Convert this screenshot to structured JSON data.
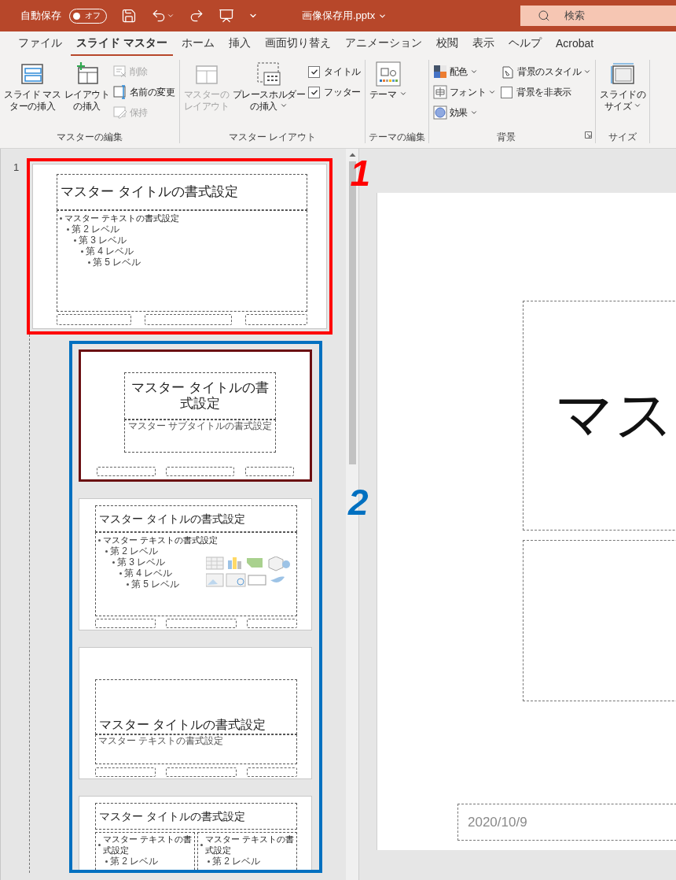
{
  "title_bar": {
    "autosave": {
      "label": "自動保存",
      "toggle": "オフ",
      "on": false
    },
    "file_name": "画像保存用.pptx",
    "search": {
      "placeholder": "検索"
    }
  },
  "tabs": [
    {
      "label": "ファイル",
      "selected": false
    },
    {
      "label": "スライド マスター",
      "selected": true
    },
    {
      "label": "ホーム",
      "selected": false
    },
    {
      "label": "挿入",
      "selected": false
    },
    {
      "label": "画面切り替え",
      "selected": false
    },
    {
      "label": "アニメーション",
      "selected": false
    },
    {
      "label": "校閲",
      "selected": false
    },
    {
      "label": "表示",
      "selected": false
    },
    {
      "label": "ヘルプ",
      "selected": false
    },
    {
      "label": "Acrobat",
      "selected": false
    }
  ],
  "ribbon": {
    "groups": [
      {
        "label": "マスターの編集",
        "items": [
          {
            "kind": "large",
            "lines": [
              "スライド マス",
              "ターの挿入"
            ],
            "disabled": false,
            "dropdown": false
          },
          {
            "kind": "large",
            "lines": [
              "レイアウト",
              "の挿入"
            ],
            "disabled": false,
            "dropdown": false
          },
          {
            "kind": "small",
            "label": "削除",
            "disabled": true,
            "dropdown": false
          },
          {
            "kind": "small",
            "label": "名前の変更",
            "disabled": false,
            "dropdown": false
          },
          {
            "kind": "small",
            "label": "保持",
            "disabled": true,
            "dropdown": false
          }
        ]
      },
      {
        "label": "マスター レイアウト",
        "items": [
          {
            "kind": "large",
            "lines": [
              "マスターの",
              "レイアウト"
            ],
            "disabled": true,
            "dropdown": false
          },
          {
            "kind": "large",
            "lines": [
              "プレースホルダー",
              "の挿入"
            ],
            "disabled": false,
            "dropdown": true
          },
          {
            "kind": "check",
            "label": "タイトル",
            "checked": true
          },
          {
            "kind": "check",
            "label": "フッター",
            "checked": true
          }
        ]
      },
      {
        "label": "テーマの編集",
        "items": [
          {
            "kind": "large",
            "lines": [
              "テーマ"
            ],
            "disabled": false,
            "dropdown": true
          }
        ]
      },
      {
        "label": "背景",
        "launcher": true,
        "items": [
          {
            "kind": "small",
            "label": "配色",
            "disabled": false,
            "dropdown": true
          },
          {
            "kind": "small",
            "label": "フォント",
            "disabled": false,
            "dropdown": true
          },
          {
            "kind": "small",
            "label": "効果",
            "disabled": false,
            "dropdown": true
          },
          {
            "kind": "small",
            "label": "背景のスタイル",
            "disabled": false,
            "dropdown": true
          },
          {
            "kind": "check",
            "label": "背景を非表示",
            "checked": false
          }
        ]
      },
      {
        "label": "サイズ",
        "items": [
          {
            "kind": "large",
            "lines": [
              "スライドの",
              "サイズ"
            ],
            "disabled": false,
            "dropdown": true
          }
        ]
      }
    ]
  },
  "slide_panel": {
    "master": {
      "number": "1",
      "selected": false,
      "title": "マスター タイトルの書式設定",
      "levels": [
        "マスター テキストの書式設定",
        "第 2 レベル",
        "第 3 レベル",
        "第 4 レベル",
        "第 5 レベル"
      ]
    },
    "layouts": [
      {
        "kind": "title",
        "selected": true,
        "title": "マスター タイトルの書式設定",
        "subtitle": "マスター サブタイトルの書式設定"
      },
      {
        "kind": "content",
        "selected": false,
        "title": "マスター タイトルの書式設定",
        "levels": [
          "マスター テキストの書式設定",
          "第 2 レベル",
          "第 3 レベル",
          "第 4 レベル",
          "第 5 レベル"
        ]
      },
      {
        "kind": "section",
        "selected": false,
        "title": "マスター タイトルの書式設定",
        "text": "マスター テキストの書式設定"
      },
      {
        "kind": "two_content",
        "selected": false,
        "title": "マスター タイトルの書式設定",
        "columns": [
          [
            "マスター テキストの書式設定",
            "第 2 レベル"
          ],
          [
            "マスター テキストの書式設定",
            "第 2 レベル"
          ]
        ]
      }
    ],
    "highlights": [
      {
        "label": "1",
        "color": "#ff0000"
      },
      {
        "label": "2",
        "color": "#0070c0"
      }
    ]
  },
  "slide_editor": {
    "title": "マス",
    "date": "2020/10/9"
  }
}
